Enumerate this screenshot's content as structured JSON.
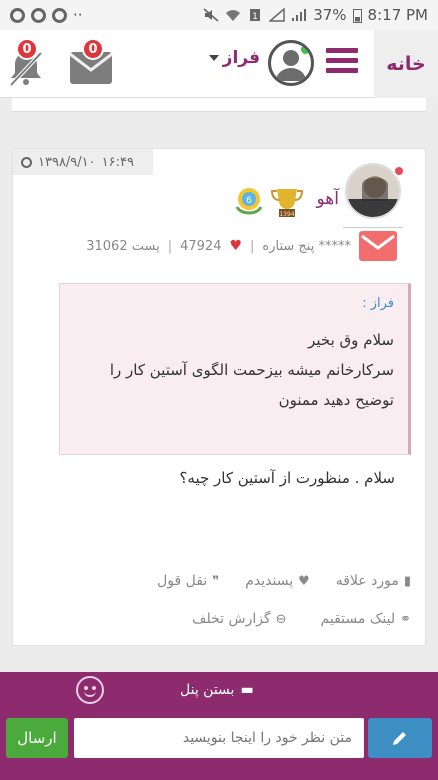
{
  "status_bar": {
    "battery": "37%",
    "time": "8:17 PM",
    "dots": "··"
  },
  "header": {
    "home_tab": "خانه",
    "username": "فراز",
    "mail_badge": "0",
    "notify_badge": "0"
  },
  "post": {
    "date": "۱۳۹۸/۹/۱۰",
    "time": "۱۶:۴۹",
    "author": "آهو",
    "rank": "پنج ستاره *****",
    "likes": "47924",
    "posts": "31062 پست",
    "quote": {
      "author": "فراز :",
      "lines": [
        "سلام وق بخیر",
        "سرکارخانم میشه بیزحمت الگوی آستین کار را",
        "توضیح دهید ممنون"
      ]
    },
    "reply": "سلام . منظورت از آستین کار چیه؟",
    "actions": {
      "favorite": "مورد علاقه",
      "like": "پسندیدم",
      "quote": "نقل قول",
      "direct_link": "لینک مستقیم",
      "report": "گزارش تخلف"
    }
  },
  "panel": {
    "close_label": "بستن پنل",
    "input_placeholder": "متن نظر خود را اینجا بنویسید",
    "send_label": "ارسال"
  },
  "colors": {
    "brand": "#8e2a6e",
    "send": "#4aaa3c",
    "edit": "#3d8fc3",
    "badge": "#e0353b"
  }
}
